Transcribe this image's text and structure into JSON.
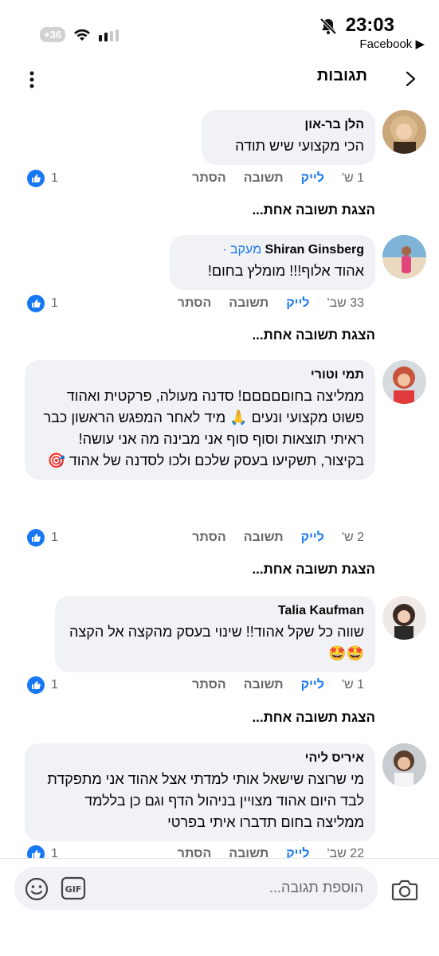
{
  "status": {
    "time": "23:03",
    "app": "Facebook ▶",
    "battery": "+36"
  },
  "header": {
    "title": "תגובות"
  },
  "comments": [
    {
      "author": "הלן בר-און",
      "badge": "",
      "text": "הכי מקצועי שיש תודה",
      "age": "1 ש'",
      "like": "לייק",
      "reply": "תשובה",
      "hide": "הסתר",
      "likes": "1",
      "replies": "הצגת תשובה אחת..."
    },
    {
      "author": "Shiran Ginsberg",
      "badge": "מעקב ·",
      "text": "אהוד אלוף!!! מומלץ בחום!",
      "age": "33 שב'",
      "like": "לייק",
      "reply": "תשובה",
      "hide": "הסתר",
      "likes": "1",
      "replies": "הצגת תשובה אחת..."
    },
    {
      "author": "תמי וטורי",
      "badge": "",
      "text": "ממליצה בחוםםםםם! סדנה מעולה, פרקטית ואהוד פשוט מקצועי ונעים 🙏 מיד לאחר המפגש הראשון כבר ראיתי תוצאות וסוף סוף אני מבינה מה אני עושה!\nבקיצור, תשקיעו בעסק שלכם ולכו לסדנה של אהוד 🎯",
      "age": "2 ש'",
      "like": "לייק",
      "reply": "תשובה",
      "hide": "הסתר",
      "likes": "1",
      "replies": "הצגת תשובה אחת..."
    },
    {
      "author": "Talia Kaufman",
      "badge": "",
      "text": "שווה כל שקל אהוד!! שינוי בעסק מהקצה אל הקצה 🤩🤩",
      "age": "1 ש'",
      "like": "לייק",
      "reply": "תשובה",
      "hide": "הסתר",
      "likes": "1",
      "replies": "הצגת תשובה אחת..."
    },
    {
      "author": "איריס ליהי",
      "badge": "",
      "text": "מי שרוצה שישאל אותי למדתי אצל אהוד אני מתפקדת לבד היום אהוד מצויין בניהול הדף וגם כן בללמד ממליצה בחום תדברו איתי בפרטי",
      "age": "22 שב'",
      "like": "לייק",
      "reply": "תשובה",
      "hide": "הסתר",
      "likes": "1",
      "replies": ""
    }
  ],
  "composer": {
    "placeholder": "הוספת תגובה..."
  }
}
